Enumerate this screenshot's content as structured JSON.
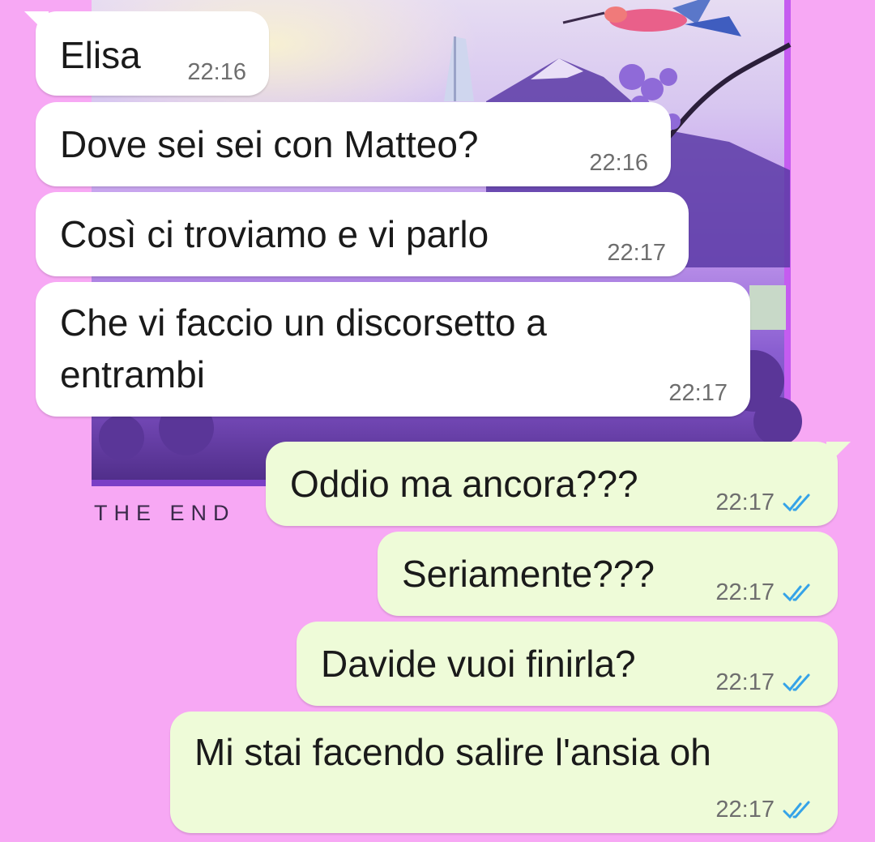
{
  "wallpaper": {
    "caption": "THE END"
  },
  "colors": {
    "background": "#f7a8f4",
    "incoming_bubble": "#ffffff",
    "outgoing_bubble": "#eefbd8",
    "read_ticks": "#35a3e8",
    "timestamp": "#6e6e6e"
  },
  "messages": [
    {
      "direction": "incoming",
      "text": "Elisa",
      "time": "22:16"
    },
    {
      "direction": "incoming",
      "text": "Dove sei sei con Matteo?",
      "time": "22:16"
    },
    {
      "direction": "incoming",
      "text": "Così ci troviamo e vi parlo",
      "time": "22:17"
    },
    {
      "direction": "incoming",
      "text": "Che vi faccio un discorsetto a\nentrambi",
      "time": "22:17"
    },
    {
      "direction": "outgoing",
      "text": "Oddio ma ancora???",
      "time": "22:17",
      "status_icon": "double-check-read-icon"
    },
    {
      "direction": "outgoing",
      "text": "Seriamente???",
      "time": "22:17",
      "status_icon": "double-check-read-icon"
    },
    {
      "direction": "outgoing",
      "text": "Davide vuoi finirla?",
      "time": "22:17",
      "status_icon": "double-check-read-icon"
    },
    {
      "direction": "outgoing",
      "text": "Mi stai facendo salire l'ansia oh",
      "time": "22:17",
      "status_icon": "double-check-read-icon"
    }
  ]
}
